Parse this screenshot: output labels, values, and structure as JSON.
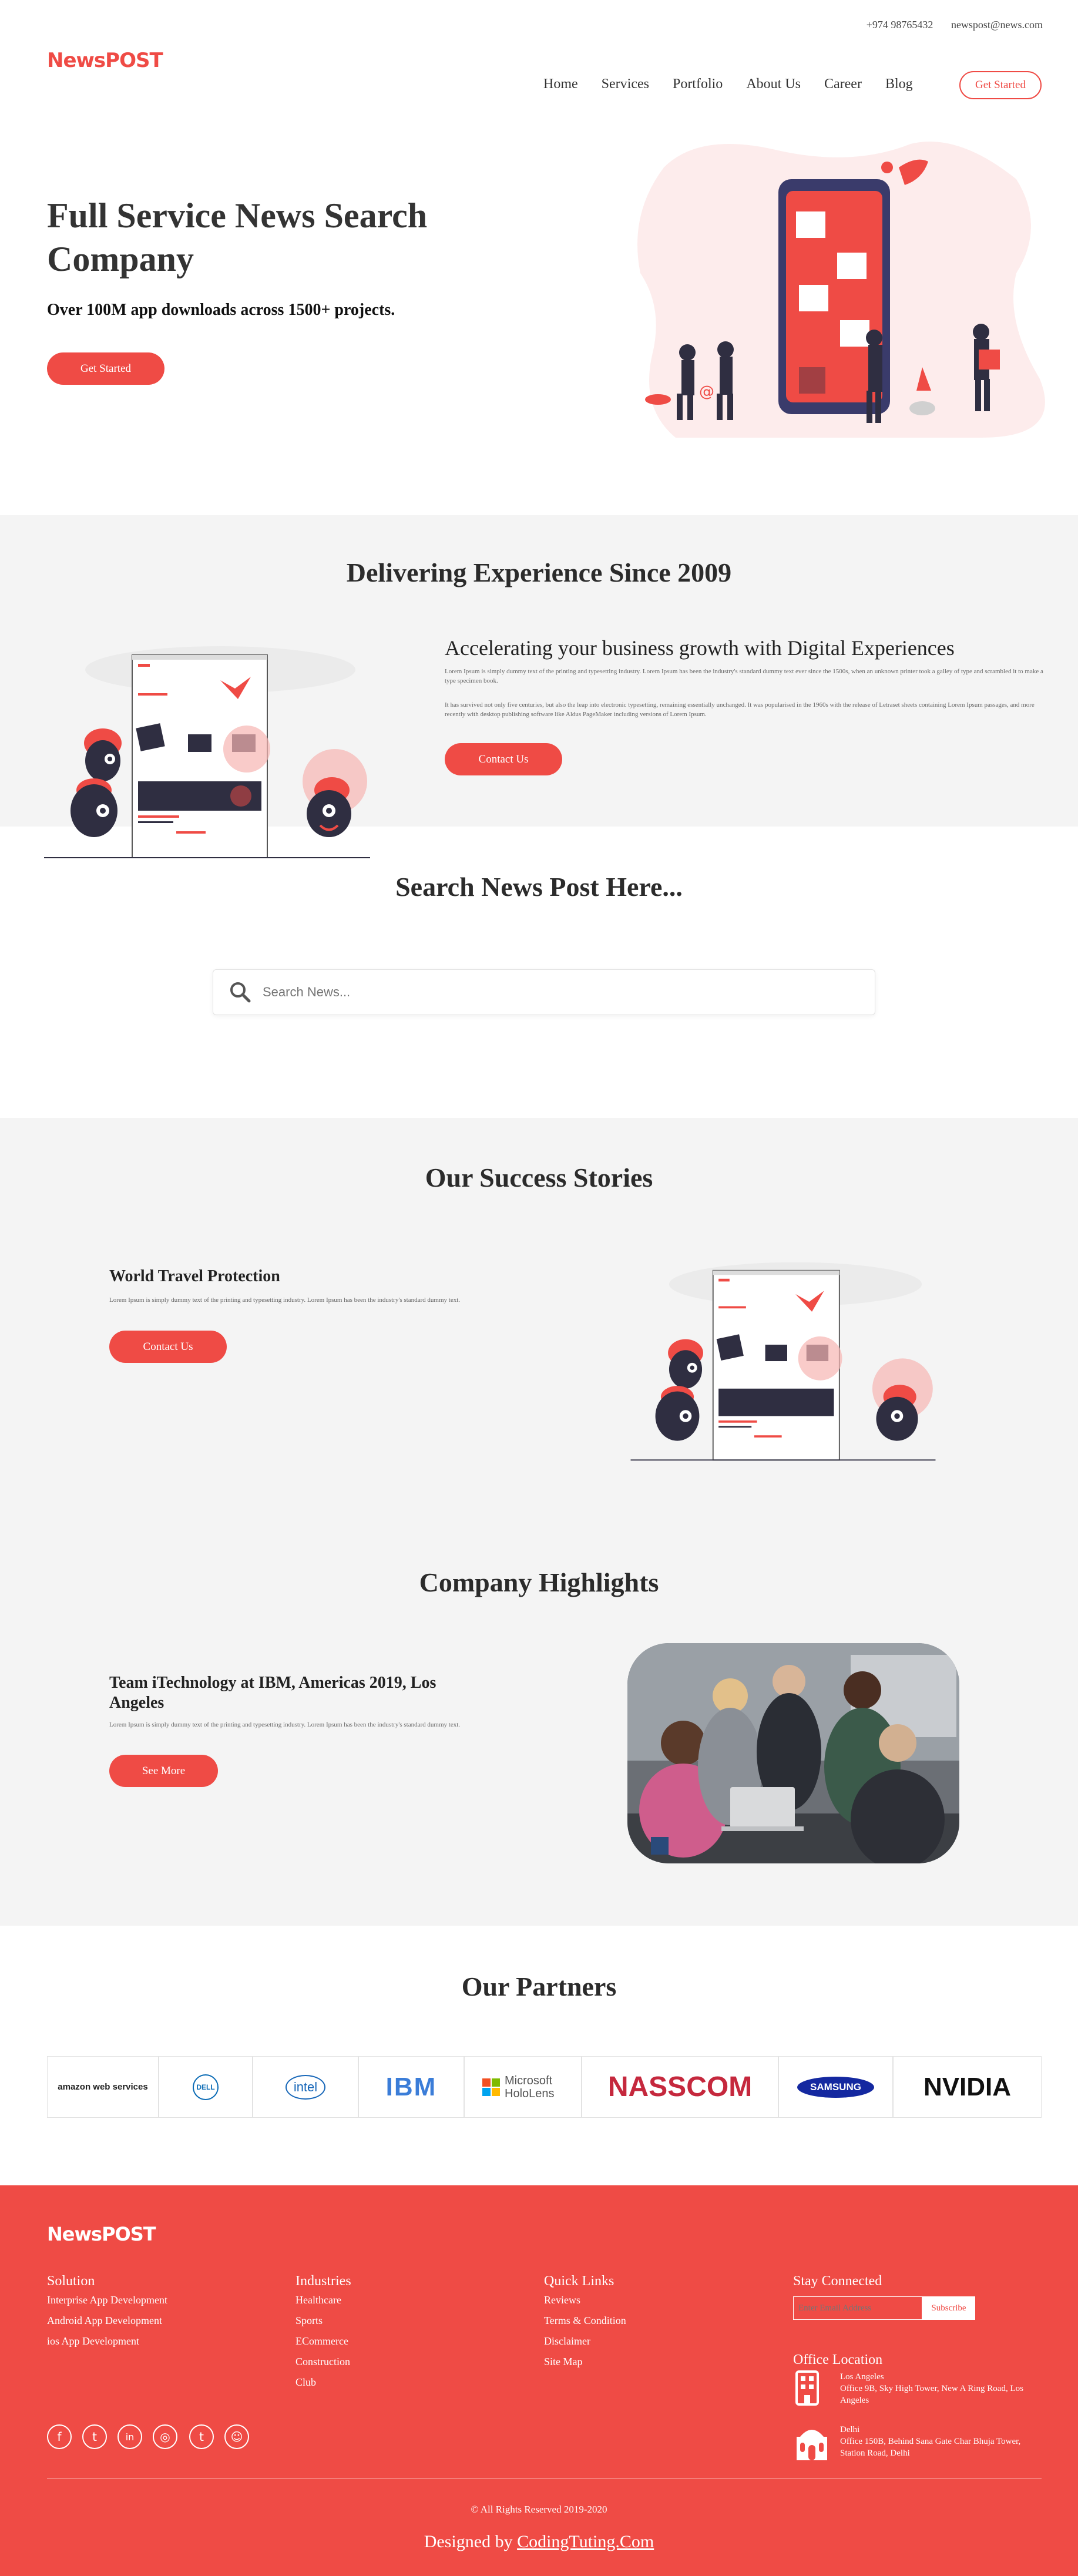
{
  "topbar": {
    "phone": "+974 98765432",
    "email": "newspost@news.com"
  },
  "header": {
    "logo": "NewsPOST",
    "nav": [
      "Home",
      "Services",
      "Portfolio",
      "About Us",
      "Career",
      "Blog"
    ],
    "cta": "Get Started"
  },
  "hero": {
    "title_line1": "Full Service News Search",
    "title_line2": "Company",
    "subtitle": "Over 100M app downloads across 1500+ projects.",
    "cta": "Get Started"
  },
  "experience": {
    "title": "Delivering Experience Since 2009",
    "heading": "Accelerating your business growth with Digital Experiences",
    "para1": "Lorem Ipsum is simply dummy text of the printing and typesetting industry. Lorem Ipsum has been the industry's standard dummy text ever since the 1500s, when an unknown printer took a galley of type and scrambled it to make a type specimen book.",
    "para2": "It has survived not only five centuries, but also the leap into electronic typesetting, remaining essentially unchanged. It was popularised in the 1960s with the release of Letraset sheets containing Lorem Ipsum passages, and more recently with desktop publishing software like Aldus PageMaker including versions of Lorem Ipsum.",
    "cta": "Contact Us"
  },
  "search": {
    "title": "Search News Post Here...",
    "placeholder": "Search News..."
  },
  "stories": {
    "title": "Our Success Stories",
    "heading": "World Travel Protection",
    "text": "Lorem Ipsum is simply dummy text of the printing and typesetting industry. Lorem Ipsum has been the industry's standard dummy text.",
    "cta": "Contact Us"
  },
  "highlights": {
    "title": "Company Highlights",
    "heading": "Team iTechnology at IBM, Americas 2019, Los Angeles",
    "text": "Lorem Ipsum is simply dummy text of the printing and typesetting industry. Lorem Ipsum has been the industry's standard dummy text.",
    "cta": "See More"
  },
  "partners": {
    "title": "Our Partners",
    "logos": [
      "amazon web services",
      "DELL",
      "intel",
      "IBM",
      "Microsoft HoloLens",
      "NASSCOM",
      "SAMSUNG",
      "NVIDIA"
    ]
  },
  "footer": {
    "logo": "NewsPOST",
    "solution": {
      "title": "Solution",
      "items": [
        "Interprise App Development",
        "Android App Development",
        "ios App Development"
      ]
    },
    "industries": {
      "title": "Industries",
      "items": [
        "Healthcare",
        "Sports",
        "ECommerce",
        "Construction",
        "Club"
      ]
    },
    "quick_links": {
      "title": "Quick Links",
      "items": [
        "Reviews",
        "Terms & Condition",
        "Disclaimer",
        "Site Map"
      ]
    },
    "stay_connected": {
      "title": "Stay Connected",
      "email_placeholder": "Enter Email Address",
      "subscribe": "Subscribe"
    },
    "office": {
      "title": "Office Location",
      "la_city": "Los Angeles",
      "la_address": "Office 9B, Sky High Tower, New A Ring Road, Los Angeles",
      "delhi_city": "Delhi",
      "delhi_address": "Office 150B, Behind Sana Gate Char Bhuja Tower, Station Road, Delhi"
    },
    "social": [
      "facebook-icon",
      "twitter-icon",
      "linkedin-icon",
      "instagram-icon",
      "tumblr-icon",
      "reddit-icon"
    ],
    "copyright": "© All Rights Reserved 2019-2020",
    "designed_by": "Designed by",
    "designer_link": "CodingTuting.Com"
  },
  "colors": {
    "accent": "#ef4b45",
    "navy": "#2f2e41",
    "gray_bg": "#f4f4f4"
  }
}
